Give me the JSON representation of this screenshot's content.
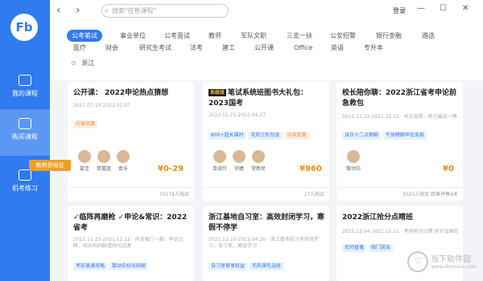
{
  "sidebar": {
    "logo": "Fb",
    "items": [
      {
        "label": "我的课程"
      },
      {
        "label": "购买课程"
      },
      {
        "label": "机考练习"
      }
    ],
    "cert_tip": "教师资格证"
  },
  "topbar": {
    "back": "‹",
    "forward": "›",
    "search_placeholder": "搜索\"在售课程\"",
    "login": "登录",
    "minimize": "—",
    "maximize": "☐",
    "close": "✕"
  },
  "categories": {
    "row1": [
      "公考笔试",
      "事业单位",
      "公考面试",
      "教师",
      "军队文职",
      "三支一扶",
      "公安招警",
      "银行金融",
      "遴选"
    ],
    "row2": [
      "医疗",
      "财会",
      "研究生考试",
      "法考",
      "建工",
      "公开课",
      "Office",
      "英语",
      "专升本"
    ],
    "region": "浙江",
    "active": "公考笔试"
  },
  "cards": [
    {
      "title": "公开课： 2022申论热点猜想",
      "date": "2017.07.10-2022.01.07",
      "tags": [
        {
          "text": "内含优惠",
          "style": "orange"
        }
      ],
      "teachers": [
        {
          "name": "葛佳"
        },
        {
          "name": "楚嘉茵"
        },
        {
          "name": "袁东"
        }
      ],
      "price": "¥0-29",
      "badge": "",
      "stats": "70174人购买"
    },
    {
      "title": "笔试系统班图书大礼包：2023国考",
      "date": "2022.02.21-2022.04.27",
      "tags": [
        {
          "text": "800+超长课时",
          "style": "blue"
        },
        {
          "text": "花药三阶包息",
          "style": "blue"
        },
        {
          "text": "内含优惠",
          "style": "orange"
        }
      ],
      "teachers": [
        {
          "name": "单淑玲"
        },
        {
          "name": "邓婕"
        },
        {
          "name": "常新民"
        }
      ],
      "price": "¥960",
      "badge": "系统班",
      "stats": "17人购买"
    },
    {
      "title": "校长陪你聊：2022浙江省考申论前急救包",
      "date": "2021.12.12-2021.12.12 · 申论急救，助力最后一搏...",
      "tags": [
        {
          "text": "当日十二点畅聊",
          "style": "blue"
        },
        {
          "text": "午休畅聊申论急救",
          "style": "blue"
        }
      ],
      "teachers": [
        {
          "name": "黎动坊"
        }
      ],
      "price": "¥0",
      "badge": "",
      "stats": "5025人购买 距售停售4天"
    },
    {
      "title": "✓临阵再磨枪 ✓申论&常识：2022省考",
      "date": "2021.11.25-2021.12.12 · 内含临门一脚，申论点睛，校长陪同聊透时间过渡",
      "tags": [
        {
          "text": "考前速通攻略",
          "style": "blue"
        },
        {
          "text": "黎动农校长陪聊",
          "style": "blue"
        }
      ],
      "teachers": [],
      "price": "",
      "badge": "",
      "stats": ""
    },
    {
      "title": "浙江基地自习室：高效封闭学习，寒假不停学",
      "date": "2021.12.20-2022.04.20 · 浙江基地自习室封闭学习，自习室，高效学习",
      "tags": [
        {
          "text": "自习室尊享权益",
          "style": "blue"
        },
        {
          "text": "先购课先选座",
          "style": "blue"
        }
      ],
      "teachers": [],
      "price": "",
      "badge": "",
      "stats": ""
    },
    {
      "title": "2022浙江抢分点睛班",
      "date": "2021.12.04-2021.12.11 · 考前抢分点睛 抢分加固班",
      "tags": [
        {
          "text": "名师直播",
          "style": "blue"
        },
        {
          "text": "临门突击",
          "style": "blue"
        }
      ],
      "teachers": [],
      "price": "",
      "badge": "",
      "stats": ""
    }
  ],
  "watermark": {
    "cn": "当下软件园",
    "en": "www.downxia.com"
  }
}
